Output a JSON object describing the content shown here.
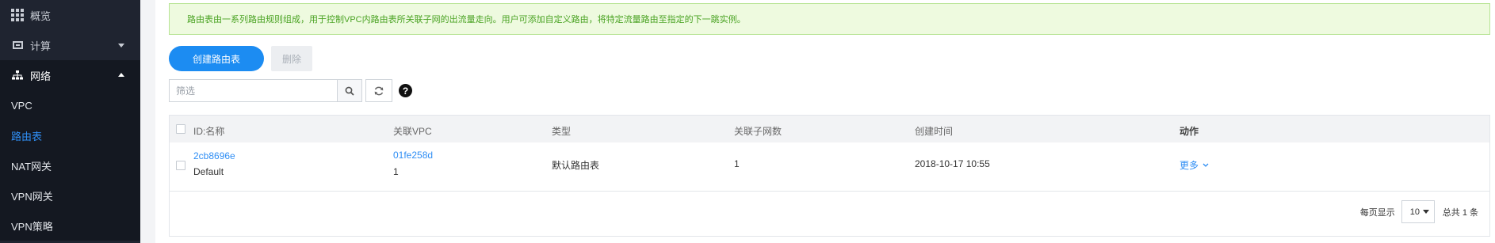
{
  "sidebar": {
    "overview": "概览",
    "compute": "计算",
    "network": "网络",
    "items": [
      {
        "label": "VPC"
      },
      {
        "label": "路由表"
      },
      {
        "label": "NAT网关"
      },
      {
        "label": "VPN网关"
      },
      {
        "label": "VPN策略"
      }
    ]
  },
  "notice": "路由表由一系列路由规则组成，用于控制VPC内路由表所关联子网的出流量走向。用户可添加自定义路由，将特定流量路由至指定的下一跳实例。",
  "toolbar": {
    "create_label": "创建路由表",
    "delete_label": "删除",
    "filter_placeholder": "筛选"
  },
  "table": {
    "headers": {
      "id_name": "ID:名称",
      "vpc": "关联VPC",
      "type": "类型",
      "subnets": "关联子网数",
      "created": "创建时间",
      "actions": "动作"
    },
    "rows": [
      {
        "id": "2cb8696e",
        "name": "Default",
        "vpc_id": "01fe258d",
        "vpc_count": "1",
        "type": "默认路由表",
        "subnets": "1",
        "created": "2018-10-17 10:55",
        "action": "更多"
      }
    ]
  },
  "pagination": {
    "per_page_label": "每页显示",
    "per_page_value": "10",
    "total_label": "总共 1 条"
  },
  "colors": {
    "primary": "#1c8cf2",
    "sidebar_bg": "#1f2430",
    "notice_green": "#4aa323"
  }
}
